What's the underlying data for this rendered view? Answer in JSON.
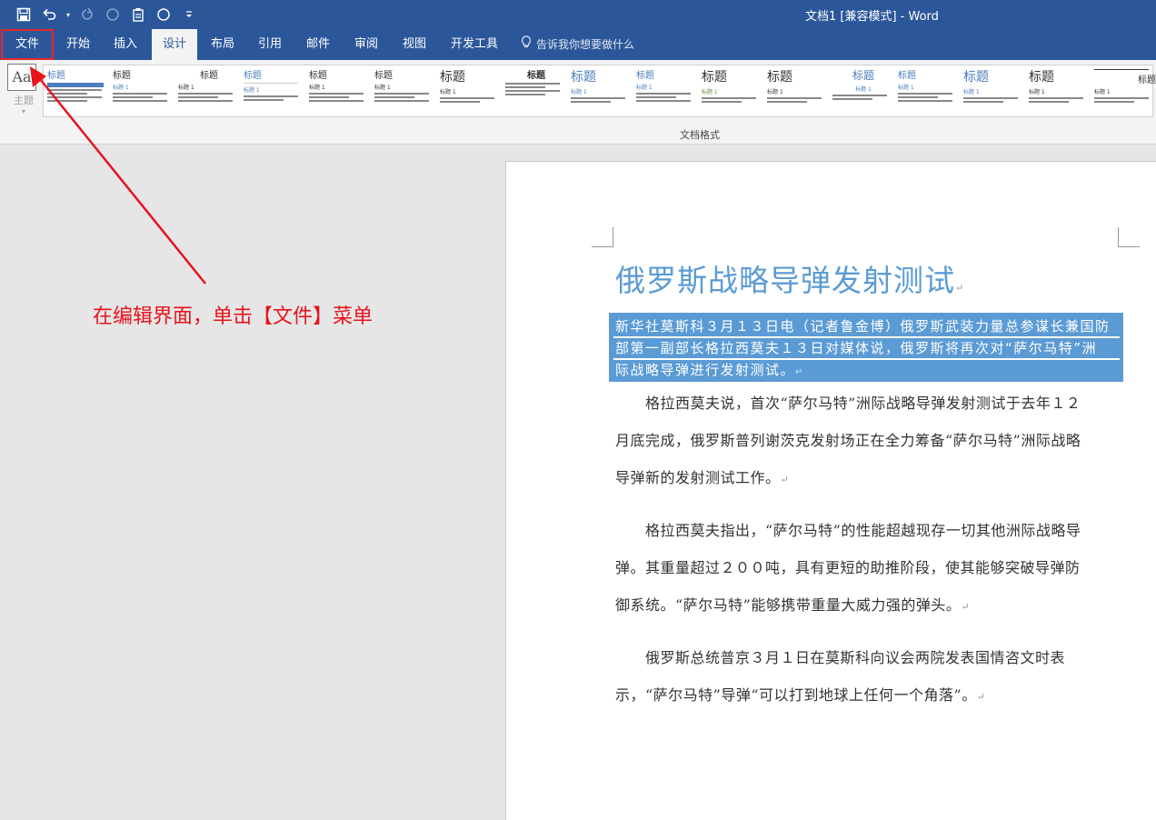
{
  "window": {
    "title": "文档1 [兼容模式]  -  Word"
  },
  "qat": {
    "icons": [
      "save-icon",
      "undo-icon",
      "undo-dropdown-icon",
      "redo-icon",
      "circle-icon",
      "clipboard-icon",
      "circle-icon",
      "customize-dropdown-icon"
    ]
  },
  "tabs": [
    {
      "label": "文件",
      "highlighted": true
    },
    {
      "label": "开始"
    },
    {
      "label": "插入"
    },
    {
      "label": "设计",
      "active": true
    },
    {
      "label": "布局"
    },
    {
      "label": "引用"
    },
    {
      "label": "邮件"
    },
    {
      "label": "审阅"
    },
    {
      "label": "视图"
    },
    {
      "label": "开发工具"
    }
  ],
  "tell_me": "告诉我你想要做什么",
  "ribbon": {
    "theme": {
      "glyph": "Aa",
      "label": "主题"
    },
    "gallery_titles": [
      "标题",
      "标题",
      "标题",
      "标题",
      "标题",
      "标题",
      "标题",
      "标题",
      "标题",
      "标题",
      "标题",
      "标题",
      "标题",
      "标题",
      "标题",
      "标题",
      "标题",
      "标题"
    ],
    "gallery_subtitles": [
      "标题 1",
      "标题 1",
      "标题 1",
      "标题 1",
      "标题 1",
      "标题 1",
      "标题 1",
      "标题 1",
      "标题 1",
      "标题 1",
      "标题 1",
      "标题 1",
      "标题 1",
      "标题 1",
      "标题 1",
      "标题 1",
      "标题 1",
      "标题 1"
    ],
    "group_label": "文档格式"
  },
  "document": {
    "title": "俄罗斯战略导弹发射测试",
    "paragraph_mark": "↵",
    "highlighted_lines": [
      "新华社莫斯科３月１３日电（记者鲁金博）俄罗斯武装力量总参谋长兼国防",
      "部第一副部长格拉西莫夫１３日对媒体说，俄罗斯将再次对“萨尔马特”洲",
      "际战略导弹进行发射测试。"
    ],
    "paragraphs": [
      [
        "　　格拉西莫夫说，首次“萨尔马特”洲际战略导弹发射测试于去年１２",
        "月底完成，俄罗斯普列谢茨克发射场正在全力筹备“萨尔马特”洲际战略",
        "导弹新的发射测试工作。"
      ],
      [
        "　　格拉西莫夫指出，“萨尔马特”的性能超越现存一切其他洲际战略导",
        "弹。其重量超过２００吨，具有更短的助推阶段，使其能够突破导弹防",
        "御系统。“萨尔马特”能够携带重量大威力强的弹头。"
      ],
      [
        "　　俄罗斯总统普京３月１日在莫斯科向议会两院发表国情咨文时表",
        "示，“萨尔马特”导弹“可以打到地球上任何一个角落”。"
      ]
    ]
  },
  "annotation": {
    "text": "在编辑界面，单击【文件】菜单",
    "color": "#e8131b"
  },
  "colors": {
    "brand": "#2b579a",
    "heading": "#5b9bd5",
    "selection": "#5b9bd5"
  }
}
